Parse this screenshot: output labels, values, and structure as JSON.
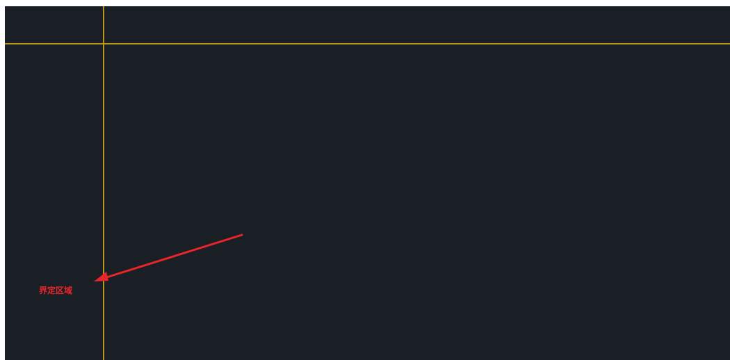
{
  "annotation": {
    "label": "界定区域",
    "color": "#e8262a"
  },
  "guides": {
    "color": "#b89618"
  },
  "canvas": {
    "background": "#1a1f26"
  }
}
